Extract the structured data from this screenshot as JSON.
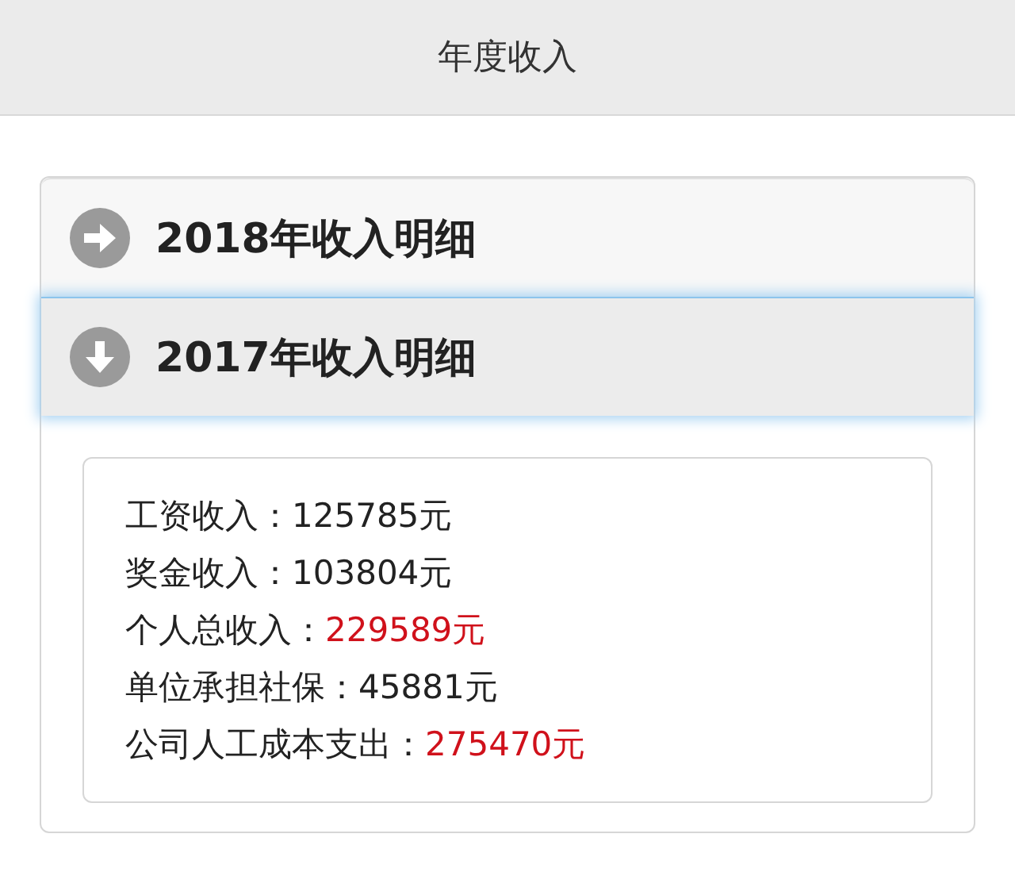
{
  "header": {
    "title": "年度收入"
  },
  "sections": [
    {
      "label": "2018年收入明细",
      "expanded": false
    },
    {
      "label": "2017年收入明细",
      "expanded": true,
      "details": [
        {
          "label": "工资收入：",
          "value": "125785元",
          "highlight": false
        },
        {
          "label": "奖金收入：",
          "value": "103804元",
          "highlight": false
        },
        {
          "label": "个人总收入：",
          "value": "229589元",
          "highlight": true
        },
        {
          "label": "单位承担社保：",
          "value": "45881元",
          "highlight": false
        },
        {
          "label": "公司人工成本支出：",
          "value": "275470元",
          "highlight": true
        }
      ]
    }
  ]
}
